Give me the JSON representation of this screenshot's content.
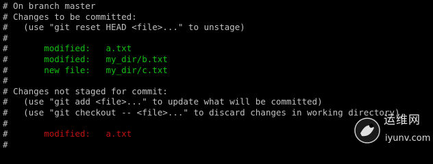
{
  "terminal": {
    "lines": [
      {
        "prefix": "#",
        "text": " On branch master"
      },
      {
        "prefix": "#",
        "text": " Changes to be committed:"
      },
      {
        "prefix": "#",
        "text": "   (use \"git reset HEAD <file>...\" to unstage)"
      },
      {
        "prefix": "#",
        "text": ""
      },
      {
        "prefix": "#",
        "text": "       ",
        "status": "modified:   a.txt",
        "kind": "staged"
      },
      {
        "prefix": "#",
        "text": "       ",
        "status": "modified:   my_dir/b.txt",
        "kind": "staged"
      },
      {
        "prefix": "#",
        "text": "       ",
        "status": "new file:   my_dir/c.txt",
        "kind": "staged"
      },
      {
        "prefix": "#",
        "text": ""
      },
      {
        "prefix": "#",
        "text": " Changes not staged for commit:"
      },
      {
        "prefix": "#",
        "text": "   (use \"git add <file>...\" to update what will be committed)"
      },
      {
        "prefix": "#",
        "text": "   (use \"git checkout -- <file>...\" to discard changes in working directory)"
      },
      {
        "prefix": "#",
        "text": ""
      },
      {
        "prefix": "#",
        "text": "       ",
        "status": "modified:   a.txt",
        "kind": "unstaged"
      },
      {
        "prefix": "#",
        "text": ""
      }
    ]
  },
  "watermark": {
    "cn_text": "运维网",
    "url": "iyunv.com"
  },
  "colors": {
    "background": "#000000",
    "text": "#c0c0c0",
    "staged": "#11c011",
    "unstaged": "#c01111"
  }
}
